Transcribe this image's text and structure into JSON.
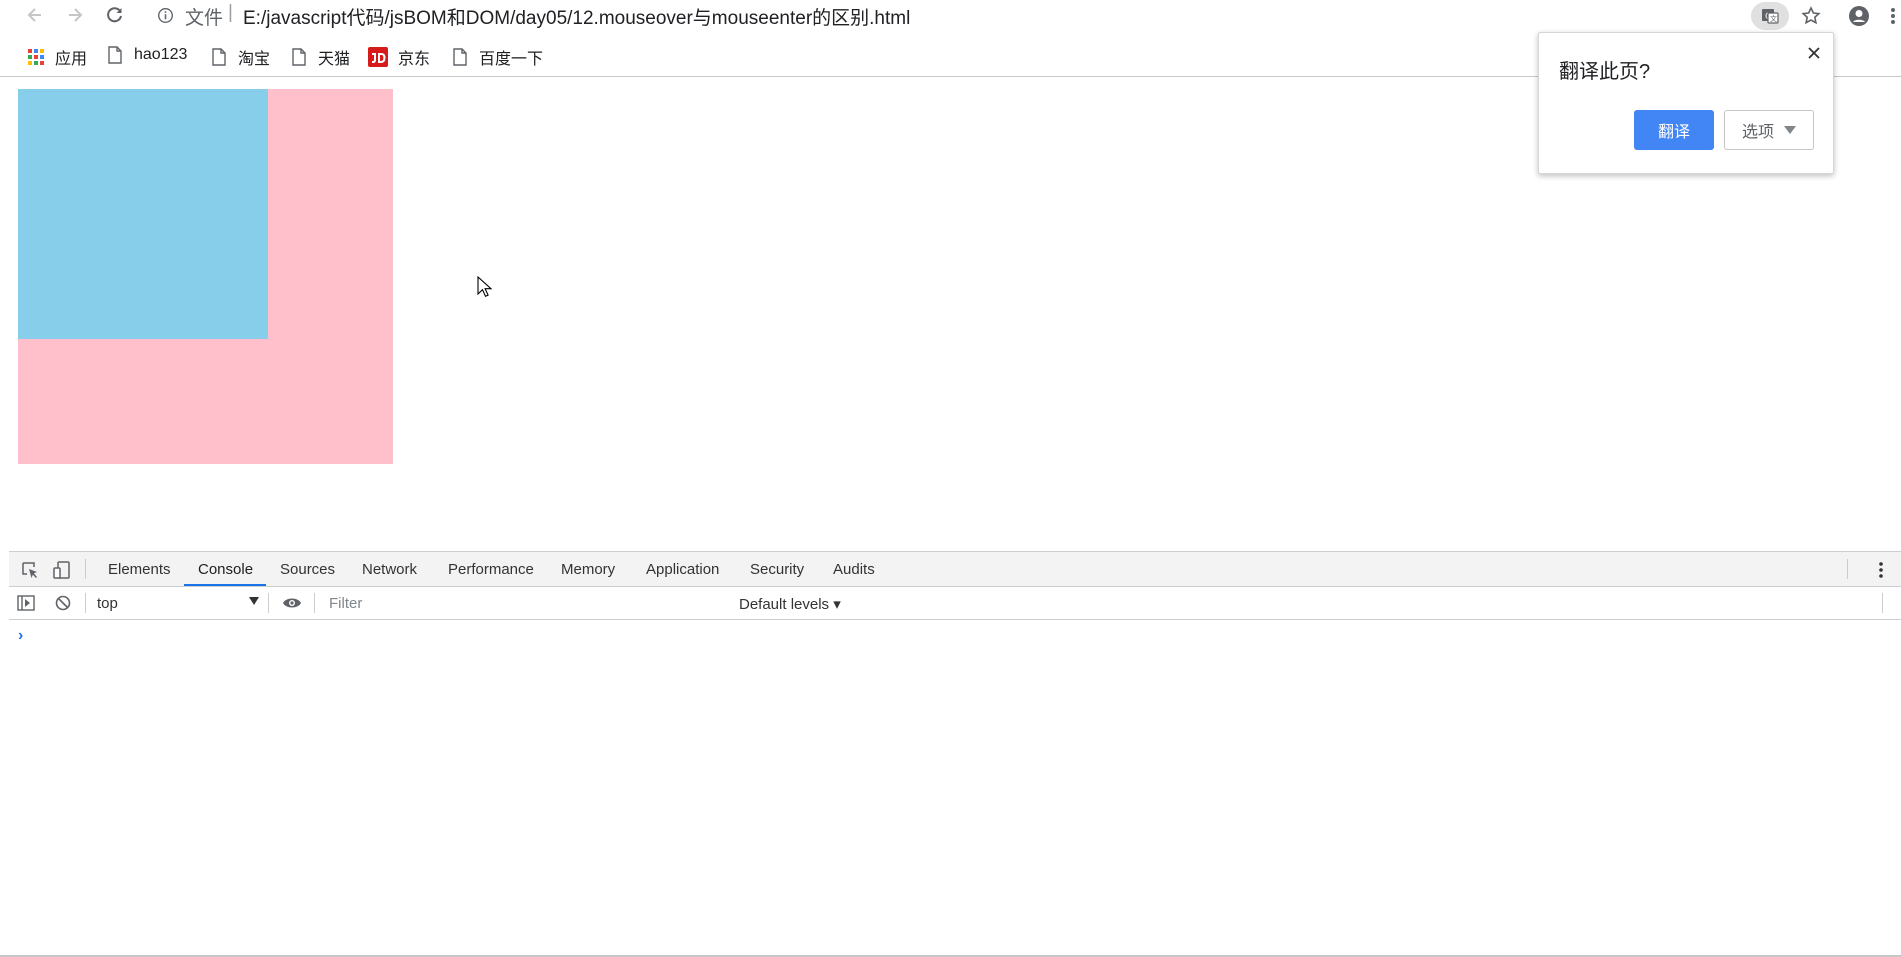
{
  "toolbar": {
    "scheme_label": "文件",
    "separator": "|",
    "url": "E:/javascript代码/jsBOM和DOM/day05/12.mouseover与mouseenter的区别.html"
  },
  "bookmarks": [
    {
      "label": "应用",
      "icon": "apps-grid-icon"
    },
    {
      "label": "hao123",
      "icon": "page-icon"
    },
    {
      "label": "淘宝",
      "icon": "page-icon"
    },
    {
      "label": "天猫",
      "icon": "page-icon"
    },
    {
      "label": "京东",
      "icon": "jd-logo-icon"
    },
    {
      "label": "百度一下",
      "icon": "page-icon"
    }
  ],
  "page": {
    "outer_box_color": "#ffc0cb",
    "inner_box_color": "#87ceeb"
  },
  "translate_popup": {
    "title": "翻译此页?",
    "translate_label": "翻译",
    "options_label": "选项"
  },
  "devtools": {
    "tabs": [
      "Elements",
      "Console",
      "Sources",
      "Network",
      "Performance",
      "Memory",
      "Application",
      "Security",
      "Audits"
    ],
    "active_tab": "Console",
    "context": "top",
    "filter_placeholder": "Filter",
    "levels_label": "Default levels ▾",
    "prompt_symbol": "›"
  },
  "colors": {
    "accent": "#1a73e8",
    "translate_button": "#4285f4"
  }
}
